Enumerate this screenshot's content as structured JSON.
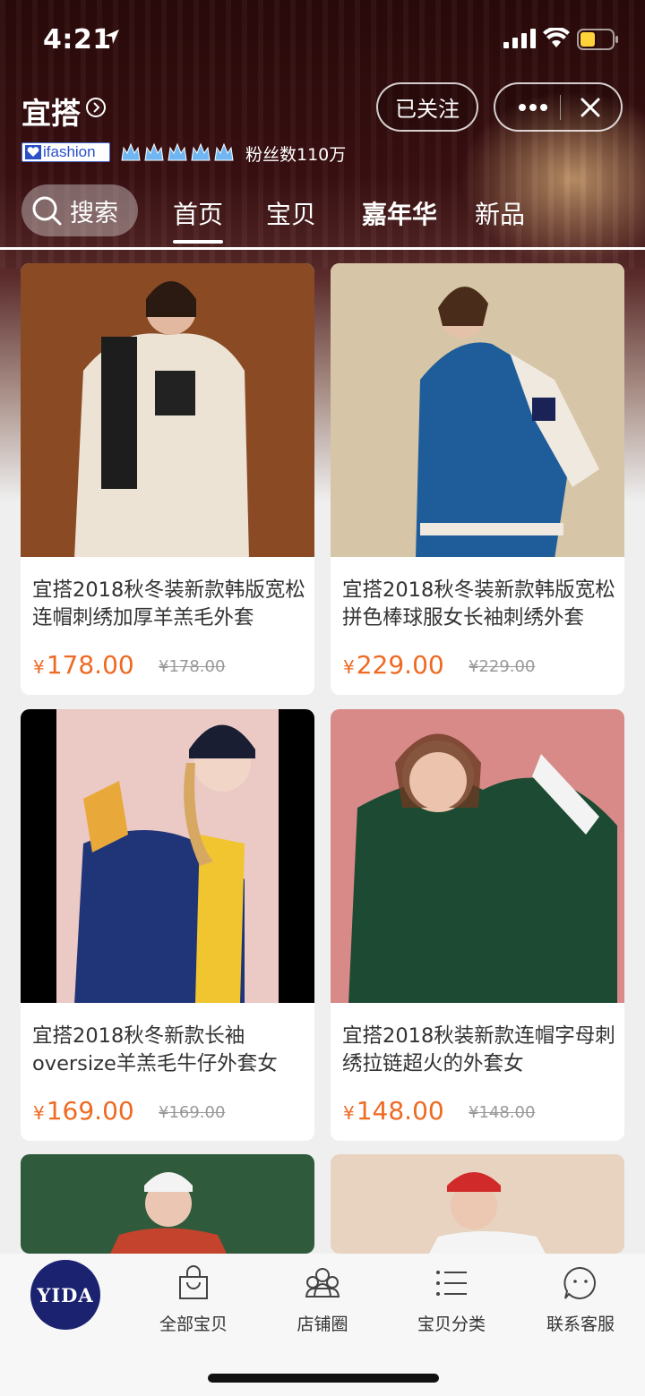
{
  "status_bar": {
    "time": "4:21"
  },
  "store": {
    "name": "宜搭",
    "follow_label": "已关注",
    "badge": "ifashion",
    "fans": "粉丝数110万"
  },
  "nav": {
    "search_label": "搜索",
    "tabs": [
      {
        "label": "首页"
      },
      {
        "label": "宝贝"
      },
      {
        "label": "嘉年华"
      },
      {
        "label": "新品"
      }
    ]
  },
  "products": [
    {
      "title": "宜搭2018秋冬装新款韩版宽松连帽刺绣加厚羊羔毛外套",
      "price": "178.00",
      "original_price": "¥178.00",
      "currency": "¥"
    },
    {
      "title": "宜搭2018秋冬装新款韩版宽松拼色棒球服女长袖刺绣外套",
      "price": "229.00",
      "original_price": "¥229.00",
      "currency": "¥"
    },
    {
      "title": "宜搭2018秋冬新款长袖oversize羊羔毛牛仔外套女",
      "price": "169.00",
      "original_price": "¥169.00",
      "currency": "¥"
    },
    {
      "title": "宜搭2018秋装新款连帽字母刺绣拉链超火的外套女",
      "price": "148.00",
      "original_price": "¥148.00",
      "currency": "¥"
    }
  ],
  "tab_bar": {
    "logo": "YIDA",
    "items": [
      {
        "label": "全部宝贝",
        "icon": "bag-icon"
      },
      {
        "label": "店铺圈",
        "icon": "people-icon"
      },
      {
        "label": "宝贝分类",
        "icon": "list-icon"
      },
      {
        "label": "联系客服",
        "icon": "chat-icon"
      }
    ]
  },
  "colors": {
    "price": "#ee6a22",
    "logo_bg": "#1b2270",
    "badge_blue": "#2a4fc8"
  }
}
